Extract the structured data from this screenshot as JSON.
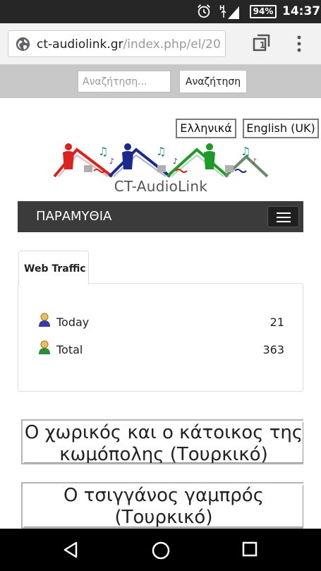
{
  "status_bar": {
    "battery_percent": "94%",
    "time": "14:37",
    "icons": [
      "alarm-icon",
      "signal-icon",
      "battery-icon"
    ]
  },
  "browser": {
    "url_domain": "ct-audiolink.gr",
    "url_path": "/index.php/el/20",
    "tab_count": "1"
  },
  "search": {
    "placeholder": "Αναζήτηση...",
    "button_label": "Αναζήτηση"
  },
  "languages": {
    "greek": "Ελληνικά",
    "english": "English (UK)"
  },
  "logo": {
    "text": "CT-AudioLink"
  },
  "nav": {
    "title": "ΠΑΡΑΜΥΘΙΑ"
  },
  "traffic": {
    "tab_label": "Web Traffic",
    "rows": [
      {
        "label": "Today",
        "value": "21"
      },
      {
        "label": "Total",
        "value": "363"
      }
    ]
  },
  "stories": [
    {
      "title": "Ο χωρικός και ο κάτοικος της κωμόπολης (Τουρκικό)"
    },
    {
      "title": "Ο τσιγγάνος γαμπρός (Τουρκικό)"
    }
  ],
  "colors": {
    "status_bar_bg": "#262626",
    "nav_bg": "#3b3b3b",
    "logo_red": "#d8231f",
    "logo_blue": "#1a2a8c",
    "logo_green": "#1f9a2a"
  }
}
